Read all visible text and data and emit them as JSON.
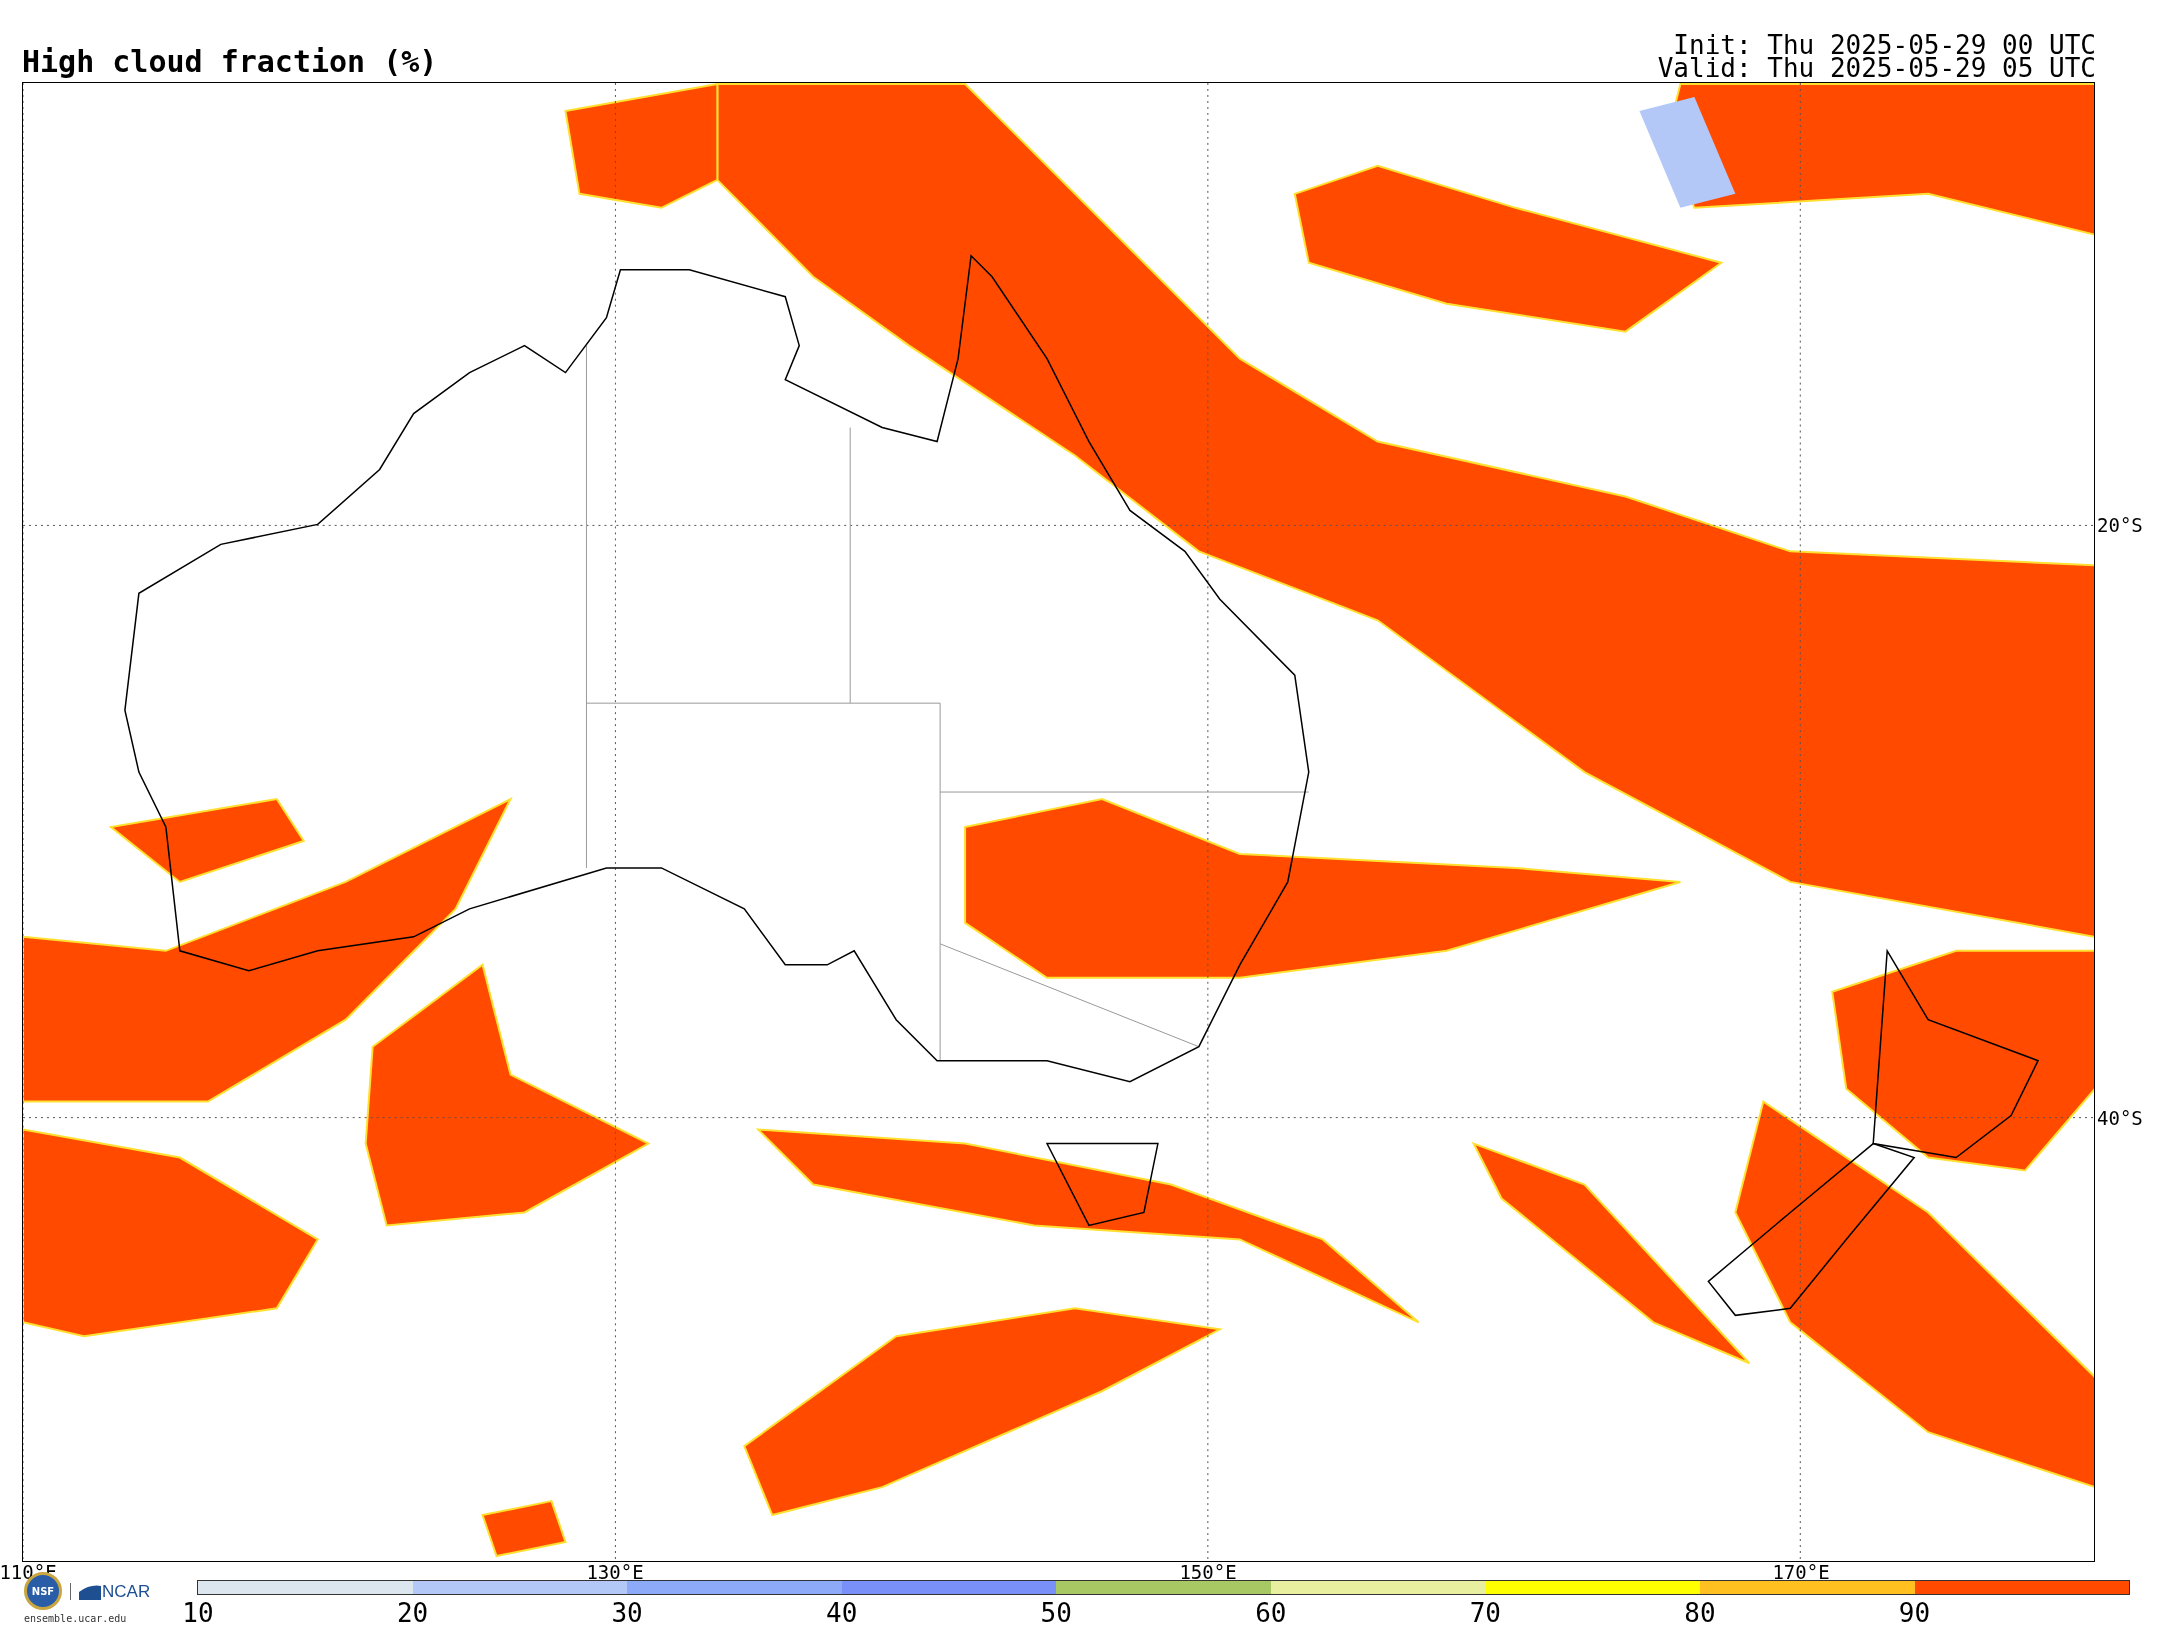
{
  "title": "High cloud fraction (%)",
  "init": "Init: Thu 2025-05-29 00 UTC",
  "valid": "Valid: Thu 2025-05-29 05 UTC",
  "longitude_labels": [
    "110°E",
    "130°E",
    "150°E",
    "170°E"
  ],
  "latitude_labels": [
    "20°S",
    "40°S"
  ],
  "logos": {
    "nsf": "NSF",
    "ncar": "NCAR",
    "url": "ensemble.ucar.edu"
  },
  "colorbar": [
    {
      "label": "10",
      "color": "#dce6ee"
    },
    {
      "label": "20",
      "color": "#b4c8f8"
    },
    {
      "label": "30",
      "color": "#8caaf8"
    },
    {
      "label": "40",
      "color": "#7890f8"
    },
    {
      "label": "50",
      "color": "#a8c864"
    },
    {
      "label": "60",
      "color": "#e8f0a0"
    },
    {
      "label": "70",
      "color": "#ffff00"
    },
    {
      "label": "80",
      "color": "#ffc020"
    },
    {
      "label": "90",
      "color": "#ff4a00"
    }
  ]
}
